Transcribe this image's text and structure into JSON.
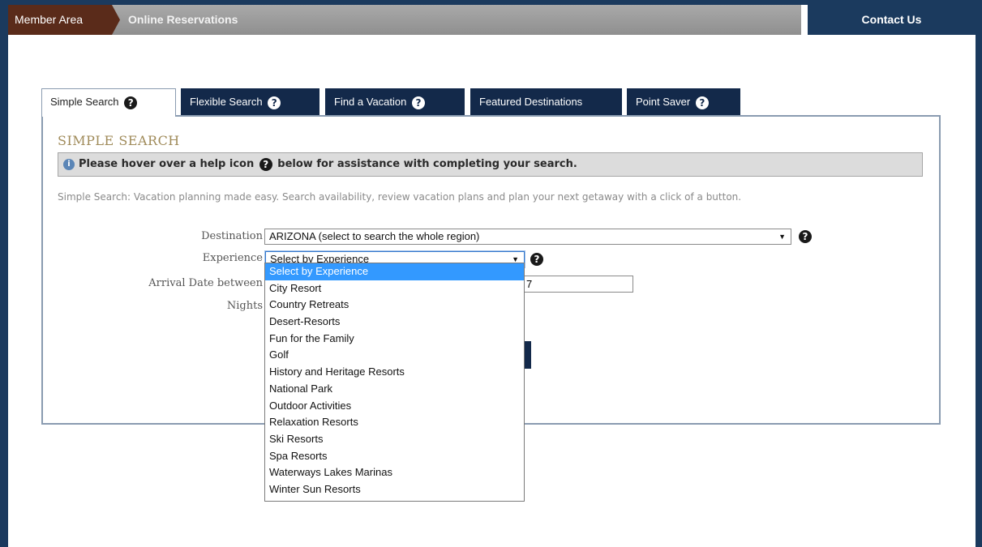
{
  "topbar": {
    "breadcrumb_home": "Member Area",
    "breadcrumb_current": "Online Reservations",
    "contact": "Contact Us"
  },
  "tabs": [
    {
      "label": "Simple Search",
      "help": "?"
    },
    {
      "label": "Flexible Search",
      "help": "?"
    },
    {
      "label": "Find a Vacation",
      "help": "?"
    },
    {
      "label": "Featured Destinations"
    },
    {
      "label": "Point Saver",
      "help": "?"
    }
  ],
  "panel": {
    "title": "SIMPLE SEARCH",
    "info_before": "Please hover over a help icon",
    "info_after": "below for assistance with completing your search.",
    "intro": "Simple Search: Vacation planning made easy. Search availability, review vacation plans and plan your next getaway with a click of a button."
  },
  "form": {
    "destination_label": "Destination",
    "destination_value": "ARIZONA (select to search the whole region)",
    "experience_label": "Experience",
    "experience_value": "Select by Experience",
    "arrival_label": "Arrival Date between",
    "arrival_partial": "7",
    "nights_label": "Nights"
  },
  "experience_options": [
    "Select by Experience",
    "City Resort",
    "Country Retreats",
    "Desert-Resorts",
    "Fun for the Family",
    "Golf",
    "History and Heritage Resorts",
    "National Park",
    "Outdoor Activities",
    "Relaxation Resorts",
    "Ski Resorts",
    "Spa Resorts",
    "Waterways Lakes Marinas",
    "Winter Sun Resorts"
  ],
  "colors": {
    "navy": "#13294a",
    "home_crumb": "#5a2b1a",
    "title_gold": "#a08b5a",
    "selected_option": "#3399ff"
  }
}
